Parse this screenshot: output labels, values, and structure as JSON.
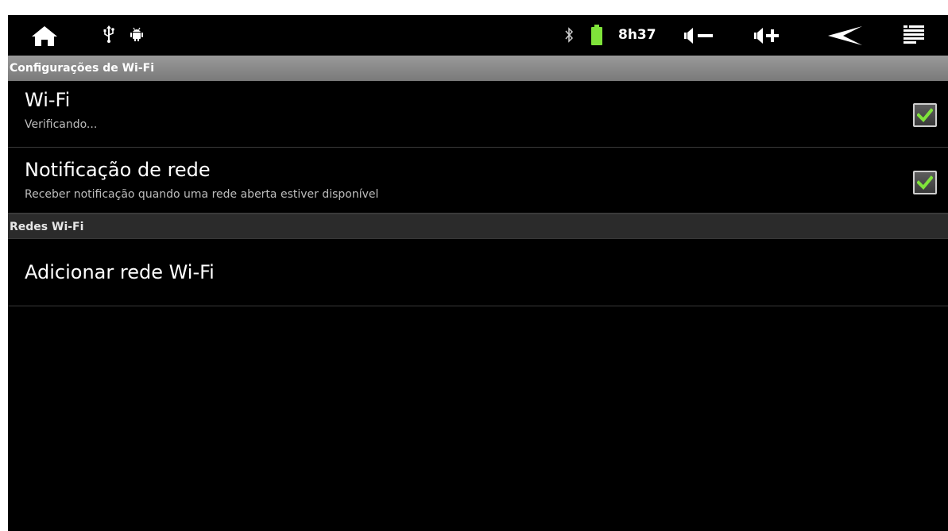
{
  "status_bar": {
    "icons": {
      "home": "home-icon",
      "usb": "usb-icon",
      "debug": "android-debug-icon",
      "bluetooth": "bluetooth-icon",
      "battery": "battery-icon",
      "volume_down": "volume-down-icon",
      "volume_up": "volume-up-icon",
      "back": "back-icon",
      "menu": "menu-icon"
    },
    "time": "8h37",
    "battery_color": "#7fe33a"
  },
  "sections": {
    "wifi_settings_title": "Configurações de Wi-Fi",
    "wifi_networks_title": "Redes Wi-Fi"
  },
  "prefs": {
    "wifi": {
      "title": "Wi-Fi",
      "summary": "Verificando...",
      "checked": true
    },
    "network_notification": {
      "title": "Notificação de rede",
      "summary": "Receber notificação quando uma rede aberta estiver disponível",
      "checked": true
    },
    "add_network": {
      "title": "Adicionar rede Wi-Fi"
    }
  },
  "colors": {
    "check_green": "#7fe33a",
    "header_gray": "#8a8a8a"
  }
}
